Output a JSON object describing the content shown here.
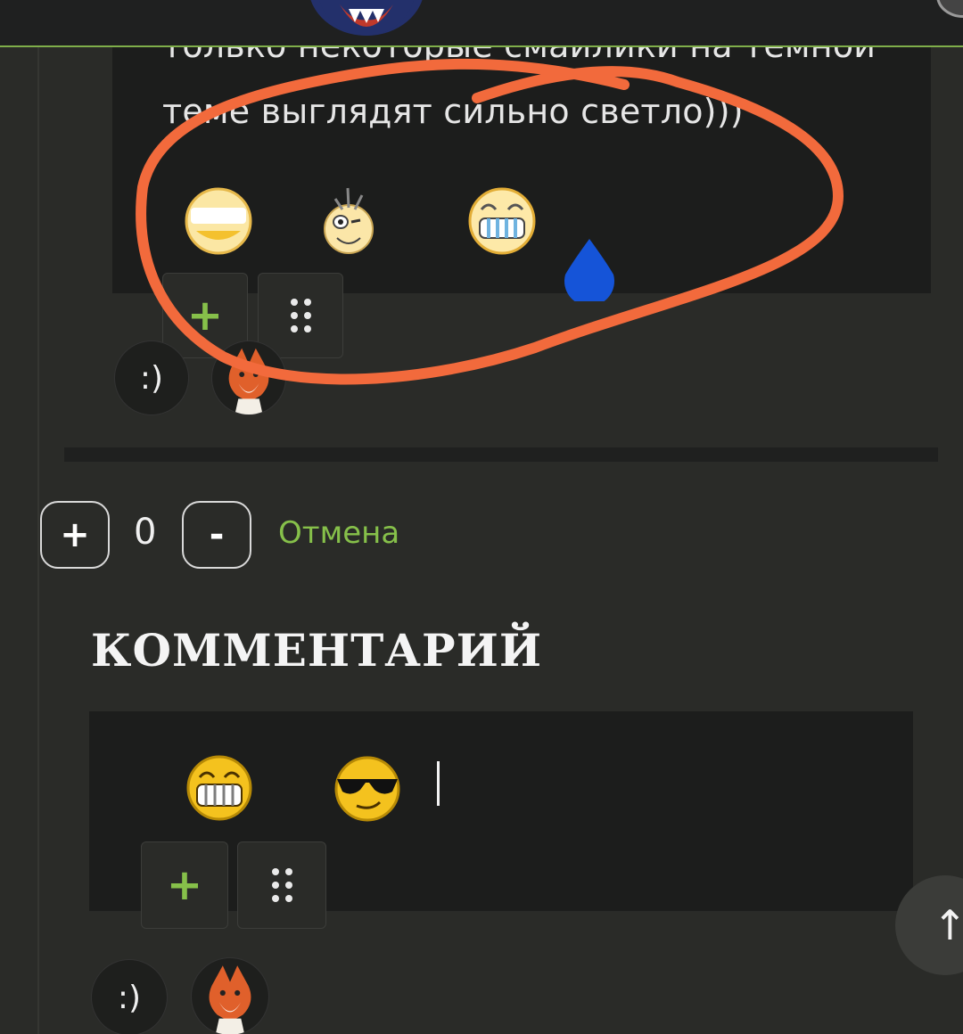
{
  "quote": {
    "line1": "только некоторые смайлики на темной",
    "line2": "теме выглядят сильно светло)))"
  },
  "toolbar": {
    "add_label": "+",
    "smile_label": ":)"
  },
  "vote": {
    "plus_label": "+",
    "count": "0",
    "minus_label": "-",
    "cancel_label": "Отмена"
  },
  "comment": {
    "title": "КОММЕНТАРИЙ"
  },
  "scroll_top": {
    "label": "↑"
  },
  "colors": {
    "accent_green": "#86c04a",
    "annotation_orange": "#f26a3c",
    "drop_blue": "#1554d8"
  },
  "icons": [
    "light-smiley-icon",
    "bee-smiley-icon",
    "grin-smiley-icon",
    "water-drop-icon",
    "fox-sticker-icon",
    "sunglasses-smiley-icon",
    "arrow-up-icon"
  ]
}
